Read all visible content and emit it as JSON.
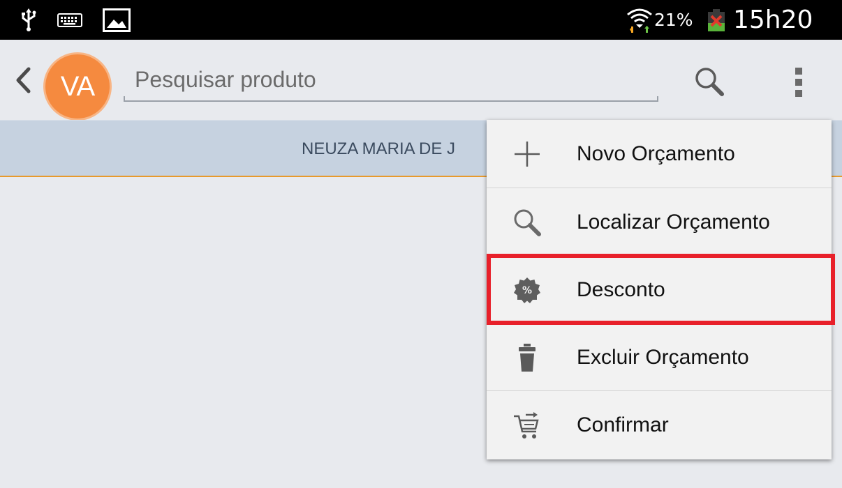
{
  "status_bar": {
    "battery_percent": "21%",
    "time": "15h20",
    "icons": [
      "usb-icon",
      "keyboard-icon",
      "image-icon",
      "wifi-icon",
      "battery-charging-icon"
    ]
  },
  "action_bar": {
    "avatar_initials": "VA",
    "search_placeholder": "Pesquisar produto",
    "icons": [
      "back-chevron-icon",
      "search-icon",
      "overflow-menu-icon"
    ],
    "avatar_color": "#f58a3f"
  },
  "client_bar": {
    "name": "NEUZA MARIA DE J",
    "accent_line_color": "#e89a2c"
  },
  "menu": {
    "items": [
      {
        "label": "Novo Orçamento",
        "icon": "plus-icon"
      },
      {
        "label": "Localizar Orçamento",
        "icon": "search-icon"
      },
      {
        "label": "Desconto",
        "icon": "discount-badge-icon"
      },
      {
        "label": "Excluir Orçamento",
        "icon": "trash-icon"
      },
      {
        "label": "Confirmar",
        "icon": "cart-icon"
      }
    ],
    "highlighted_item": "Desconto",
    "highlight_color": "#e8202a"
  }
}
